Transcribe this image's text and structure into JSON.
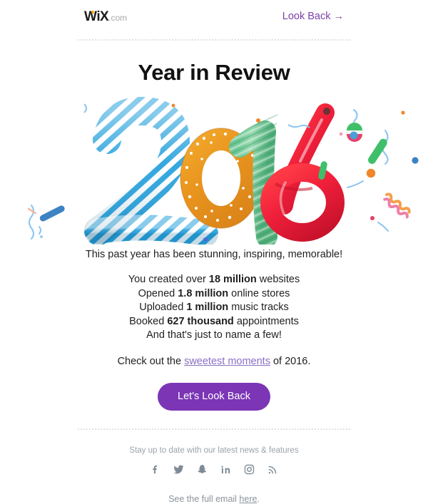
{
  "header": {
    "logo_main": "WiX",
    "logo_suffix": ".com",
    "logo_dot_color": "#f7a400",
    "look_back_link": "Look Back →",
    "link_color": "#7b3fa8"
  },
  "title": "Year in Review",
  "hero": {
    "year": "2016",
    "digits": [
      {
        "char": "2",
        "style": "blue-white-candy-cane-stripes"
      },
      {
        "char": "0",
        "style": "orange-donut-with-white-sprinkles"
      },
      {
        "char": "1",
        "style": "green-twisted-rope-candy"
      },
      {
        "char": "6",
        "style": "glossy-red-balloon"
      }
    ],
    "confetti_colors": [
      "#4a90d9",
      "#f0862a",
      "#3fbf6a",
      "#e8406a",
      "#a8d2f0",
      "#f7c6a0"
    ]
  },
  "copy": {
    "lede": "This past year has been stunning, inspiring, memorable!",
    "stats": [
      {
        "pre": "You created over ",
        "value": "18 million",
        "post": " websites"
      },
      {
        "pre": "Opened ",
        "value": "1.8 million",
        "post": " online stores"
      },
      {
        "pre": "Uploaded ",
        "value": "1 million",
        "post": " music tracks"
      },
      {
        "pre": "Booked ",
        "value": "627 thousand",
        "post": " appointments"
      }
    ],
    "stats_closer": "And that's just to name a few!",
    "closing_pre": "Check out the ",
    "closing_link": "sweetest moments",
    "closing_post": " of 2016."
  },
  "cta": {
    "label": "Let's Look Back",
    "color": "#7b35b5"
  },
  "footer": {
    "tagline": "Stay up to date with our latest news & features",
    "social": [
      {
        "name": "facebook-icon",
        "glyph": "f"
      },
      {
        "name": "twitter-icon",
        "glyph": "twitter"
      },
      {
        "name": "snapchat-icon",
        "glyph": "ghost"
      },
      {
        "name": "linkedin-icon",
        "glyph": "in"
      },
      {
        "name": "instagram-icon",
        "glyph": "camera"
      },
      {
        "name": "rss-icon",
        "glyph": "rss"
      }
    ],
    "full_email_pre": "See the full email ",
    "full_email_link": "here",
    "full_email_post": "."
  }
}
